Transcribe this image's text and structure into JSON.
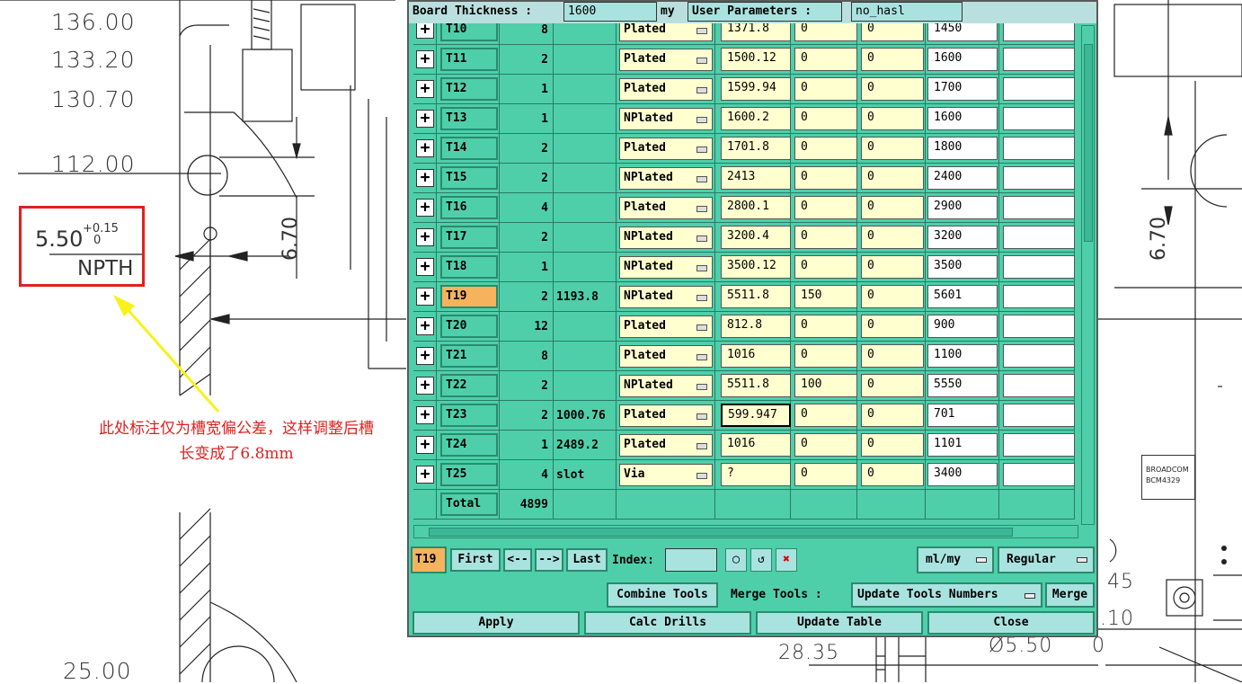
{
  "background": {
    "dims_left": [
      "136.00",
      "133.20",
      "130.70",
      "112.00",
      "25.00"
    ],
    "annotation": {
      "main": "5.50",
      "tol_upper": "+0.15",
      "tol_lower": "0",
      "type": "NPTH"
    },
    "dim_rotated_left": "6.70",
    "dim_rotated_right": "6.70",
    "note": "此处标注仅为槽宽偏公差，这样调整后槽长变成了6.8mm",
    "chip": {
      "line1": "BROADCOM",
      "line2": "BCM4329"
    },
    "right_dims": [
      "45",
      ".10",
      "Ø5.50",
      "0"
    ],
    "bottom_dim": "28.35",
    "accent_red": "#e02020",
    "accent_yellow": "#f7f21a"
  },
  "header": {
    "board_thickness_label": "Board Thickness :",
    "board_thickness_value": "1600",
    "unit": "my",
    "user_params_label": "User Parameters :",
    "user_params_value": "no_hasl"
  },
  "rows": [
    {
      "tool": "T10",
      "count": "8",
      "size": "",
      "type": "Plated",
      "v1": "1371.8",
      "v2": "0",
      "v3": "0",
      "v4": "1450",
      "v5": ""
    },
    {
      "tool": "T11",
      "count": "2",
      "size": "",
      "type": "Plated",
      "v1": "1500.12",
      "v2": "0",
      "v3": "0",
      "v4": "1600",
      "v5": ""
    },
    {
      "tool": "T12",
      "count": "1",
      "size": "",
      "type": "Plated",
      "v1": "1599.94",
      "v2": "0",
      "v3": "0",
      "v4": "1700",
      "v5": ""
    },
    {
      "tool": "T13",
      "count": "1",
      "size": "",
      "type": "NPlated",
      "v1": "1600.2",
      "v2": "0",
      "v3": "0",
      "v4": "1600",
      "v5": ""
    },
    {
      "tool": "T14",
      "count": "2",
      "size": "",
      "type": "Plated",
      "v1": "1701.8",
      "v2": "0",
      "v3": "0",
      "v4": "1800",
      "v5": ""
    },
    {
      "tool": "T15",
      "count": "2",
      "size": "",
      "type": "NPlated",
      "v1": "2413",
      "v2": "0",
      "v3": "0",
      "v4": "2400",
      "v5": ""
    },
    {
      "tool": "T16",
      "count": "4",
      "size": "",
      "type": "Plated",
      "v1": "2800.1",
      "v2": "0",
      "v3": "0",
      "v4": "2900",
      "v5": ""
    },
    {
      "tool": "T17",
      "count": "2",
      "size": "",
      "type": "NPlated",
      "v1": "3200.4",
      "v2": "0",
      "v3": "0",
      "v4": "3200",
      "v5": ""
    },
    {
      "tool": "T18",
      "count": "1",
      "size": "",
      "type": "NPlated",
      "v1": "3500.12",
      "v2": "0",
      "v3": "0",
      "v4": "3500",
      "v5": ""
    },
    {
      "tool": "T19",
      "count": "2",
      "size": "1193.8",
      "type": "NPlated",
      "v1": "5511.8",
      "v2": "150",
      "v3": "0",
      "v4": "5601",
      "v5": ""
    },
    {
      "tool": "T20",
      "count": "12",
      "size": "",
      "type": "Plated",
      "v1": "812.8",
      "v2": "0",
      "v3": "0",
      "v4": "900",
      "v5": ""
    },
    {
      "tool": "T21",
      "count": "8",
      "size": "",
      "type": "Plated",
      "v1": "1016",
      "v2": "0",
      "v3": "0",
      "v4": "1100",
      "v5": ""
    },
    {
      "tool": "T22",
      "count": "2",
      "size": "",
      "type": "NPlated",
      "v1": "5511.8",
      "v2": "100",
      "v3": "0",
      "v4": "5550",
      "v5": ""
    },
    {
      "tool": "T23",
      "count": "2",
      "size": "1000.76",
      "type": "Plated",
      "v1": "599.947",
      "v2": "0",
      "v3": "0",
      "v4": "701",
      "v5": ""
    },
    {
      "tool": "T24",
      "count": "1",
      "size": "2489.2",
      "type": "Plated",
      "v1": "1016",
      "v2": "0",
      "v3": "0",
      "v4": "1101",
      "v5": ""
    },
    {
      "tool": "T25",
      "count": "4",
      "size": "slot",
      "type": "Via",
      "v1": "?",
      "v2": "0",
      "v3": "0",
      "v4": "3400",
      "v5": ""
    }
  ],
  "total": {
    "label": "Total",
    "count": "4899"
  },
  "nav": {
    "current": "T19",
    "first": "First",
    "prev": "<--",
    "next": "-->",
    "last": "Last",
    "index_label": "Index:",
    "index_value": "",
    "units": "ml/my",
    "mode": "Regular"
  },
  "actions": {
    "combine": "Combine Tools",
    "merge_label": "Merge Tools :",
    "update_numbers": "Update Tools Numbers",
    "merge": "Merge",
    "apply": "Apply",
    "calc": "Calc Drills",
    "update_table": "Update Table",
    "close": "Close"
  }
}
